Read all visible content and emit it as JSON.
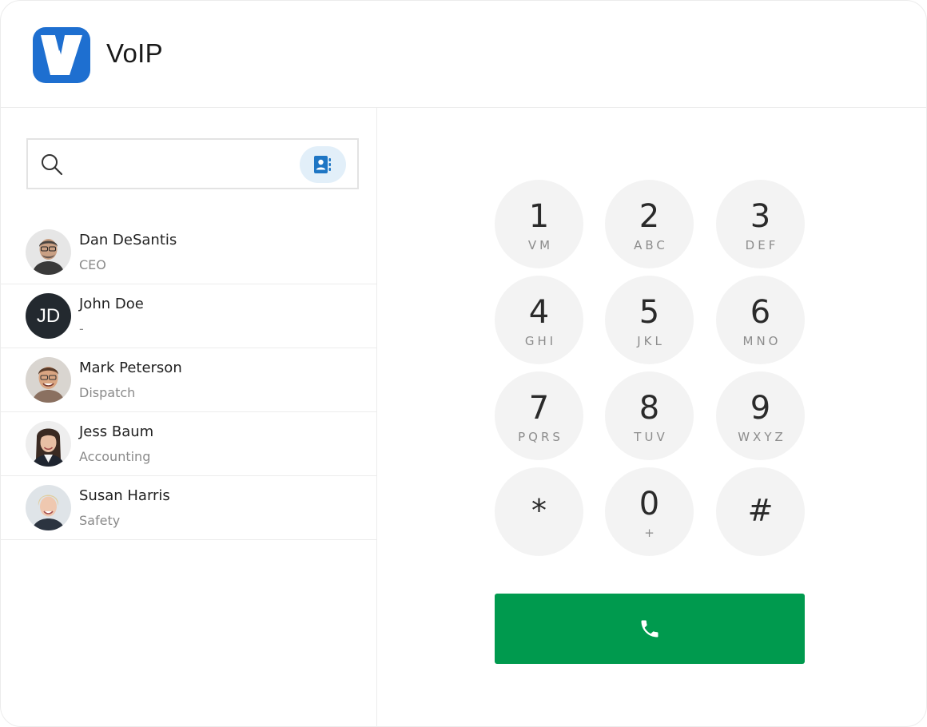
{
  "app": {
    "title": "VoIP",
    "logo_icon": "voip-v-logo-icon"
  },
  "colors": {
    "brand": "#1e6fd0",
    "call": "#009a4e",
    "contacts_btn_bg": "#e2eff9",
    "key_bg": "#f3f3f3"
  },
  "search": {
    "placeholder": "",
    "value": "",
    "icon": "search-icon",
    "contacts_icon": "address-book-icon"
  },
  "contacts": [
    {
      "name": "Dan DeSantis",
      "role": "CEO",
      "avatar": "photo"
    },
    {
      "name": "John Doe",
      "role": "-",
      "avatar": "initials",
      "initials": "JD"
    },
    {
      "name": "Mark Peterson",
      "role": "Dispatch",
      "avatar": "photo"
    },
    {
      "name": "Jess Baum",
      "role": "Accounting",
      "avatar": "photo"
    },
    {
      "name": "Susan Harris",
      "role": "Safety",
      "avatar": "photo"
    }
  ],
  "keypad": [
    {
      "digit": "1",
      "letters": "VM"
    },
    {
      "digit": "2",
      "letters": "ABC"
    },
    {
      "digit": "3",
      "letters": "DEF"
    },
    {
      "digit": "4",
      "letters": "GHI"
    },
    {
      "digit": "5",
      "letters": "JKL"
    },
    {
      "digit": "6",
      "letters": "MNO"
    },
    {
      "digit": "7",
      "letters": "PQRS"
    },
    {
      "digit": "8",
      "letters": "TUV"
    },
    {
      "digit": "9",
      "letters": "WXYZ"
    },
    {
      "digit": "*",
      "letters": ""
    },
    {
      "digit": "0",
      "letters": "+"
    },
    {
      "digit": "#",
      "letters": ""
    }
  ],
  "call_button": {
    "icon": "phone-icon"
  }
}
